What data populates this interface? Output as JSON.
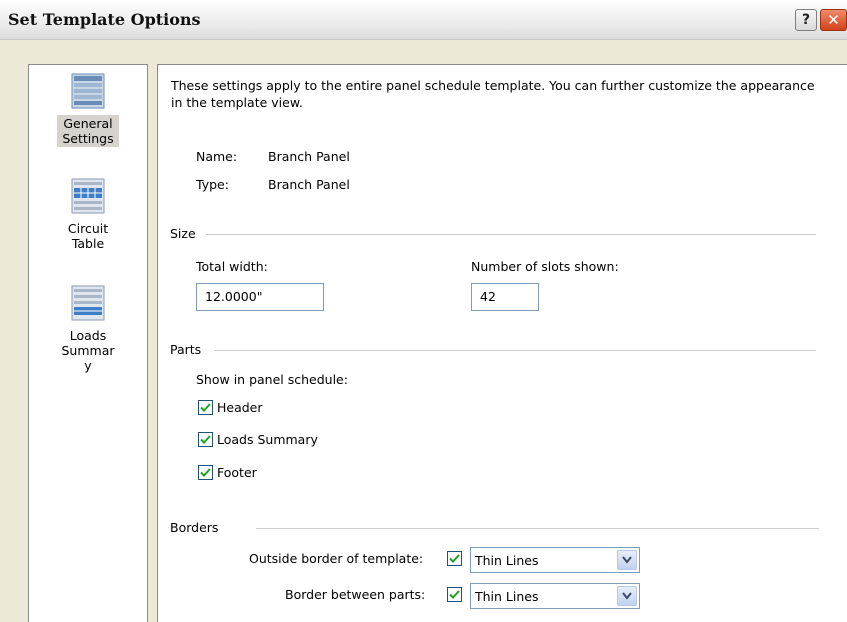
{
  "window": {
    "title": "Set Template Options",
    "help_glyph": "?",
    "close_glyph": "✕"
  },
  "nav": {
    "items": [
      {
        "label": "General Settings",
        "icon": "general-settings-icon",
        "active": true
      },
      {
        "label": "Circuit Table",
        "icon": "circuit-table-icon",
        "active": false
      },
      {
        "label": "Loads Summary",
        "icon": "loads-summary-icon",
        "active": false
      }
    ]
  },
  "content": {
    "intro": "These settings apply to the entire panel schedule template. You can further customize the appearance in the template view.",
    "name_label": "Name:",
    "name_value": "Branch Panel",
    "type_label": "Type:",
    "type_value": "Branch Panel",
    "size": {
      "title": "Size",
      "total_width_label": "Total width:",
      "total_width_value": "12.0000\"",
      "slots_label": "Number of slots shown:",
      "slots_value": "42"
    },
    "parts": {
      "title": "Parts",
      "show_label": "Show in panel schedule:",
      "items": [
        {
          "label": "Header",
          "checked": true
        },
        {
          "label": "Loads Summary",
          "checked": true
        },
        {
          "label": "Footer",
          "checked": true
        }
      ]
    },
    "borders": {
      "title": "Borders",
      "outside_label": "Outside border of template:",
      "outside_checked": true,
      "outside_value": "Thin Lines",
      "between_label": "Border between parts:",
      "between_checked": true,
      "between_value": "Thin Lines"
    }
  },
  "colors": {
    "dialog_bg": "#ece9d8",
    "close_button": "#d2411a",
    "checkmark": "#21a121",
    "icon_blue": "#6a8db8"
  }
}
